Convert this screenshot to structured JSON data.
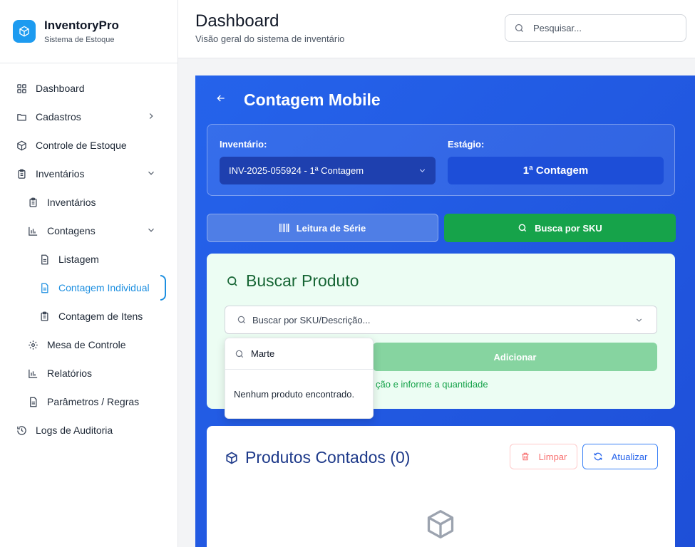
{
  "brand": {
    "title": "InventoryPro",
    "subtitle": "Sistema de Estoque"
  },
  "sidebar": {
    "items": [
      {
        "label": "Dashboard",
        "icon": "grid-icon"
      },
      {
        "label": "Cadastros",
        "icon": "folder-icon"
      },
      {
        "label": "Controle de Estoque",
        "icon": "box-icon"
      },
      {
        "label": "Inventários",
        "icon": "clipboard-icon"
      },
      {
        "label": "Inventários",
        "icon": "clipboard-icon"
      },
      {
        "label": "Contagens",
        "icon": "bar-chart-icon"
      },
      {
        "label": "Listagem",
        "icon": "file-icon"
      },
      {
        "label": "Contagem Individual",
        "icon": "file-icon"
      },
      {
        "label": "Contagem de Itens",
        "icon": "clipboard-icon"
      },
      {
        "label": "Mesa de Controle",
        "icon": "gear-icon"
      },
      {
        "label": "Relatórios",
        "icon": "bar-chart-icon"
      },
      {
        "label": "Parâmetros / Regras",
        "icon": "file-icon"
      },
      {
        "label": "Logs de Auditoria",
        "icon": "history-icon"
      }
    ]
  },
  "header": {
    "title": "Dashboard",
    "subtitle": "Visão geral do sistema de inventário",
    "search_placeholder": "Pesquisar..."
  },
  "panel": {
    "title": "Contagem Mobile",
    "inventory_label": "Inventário:",
    "inventory_value": "INV-2025-055924 - 1ª Contagem",
    "stage_label": "Estágio:",
    "stage_value": "1ª Contagem",
    "mode_serial": "Leitura de Série",
    "mode_sku": "Busca por SKU"
  },
  "search_card": {
    "title": "Buscar Produto",
    "select_placeholder": "Buscar por SKU/Descrição...",
    "add_label": "Adicionar",
    "hint": "ção e informe a quantidade"
  },
  "dropdown": {
    "query": "Marte",
    "empty_text": "Nenhum produto encontrado."
  },
  "counted_card": {
    "title": "Produtos Contados (0)",
    "clear_label": "Limpar",
    "refresh_label": "Atualizar"
  },
  "colors": {
    "accent": "#1d8fe0",
    "panel_blue": "#2563eb",
    "success_green": "#16a34a",
    "danger_red": "#f87171"
  }
}
